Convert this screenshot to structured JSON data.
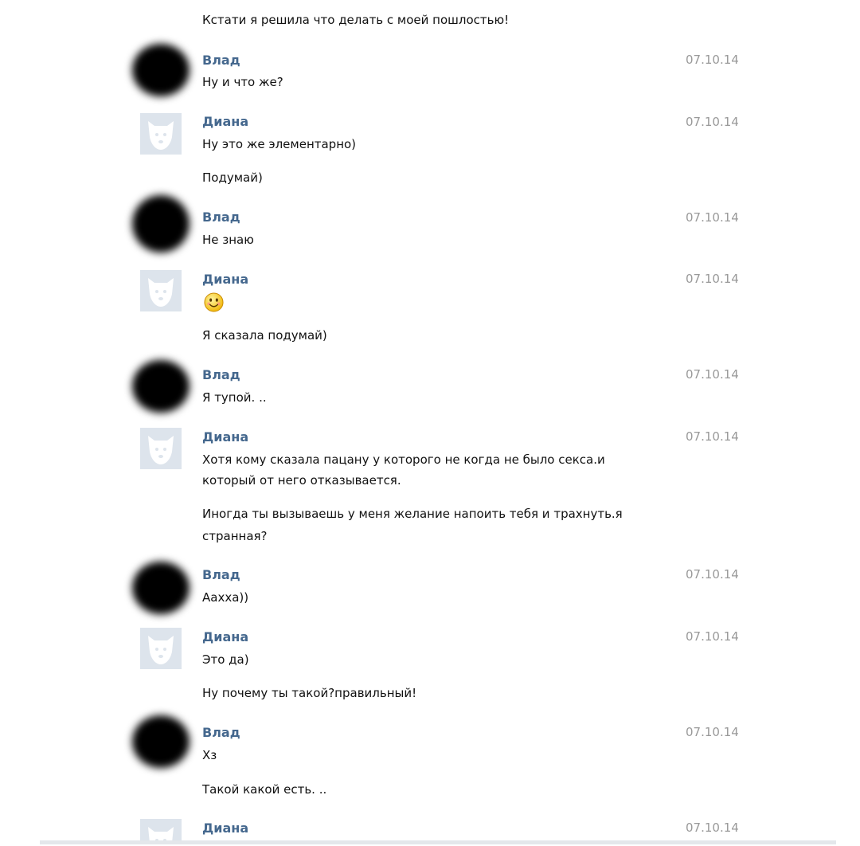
{
  "messages": [
    {
      "type": "text",
      "text": "Кстати я решила что делать с моей пошлостью!"
    },
    {
      "type": "header",
      "author": "Влад",
      "date": "07.10.14"
    },
    {
      "type": "text",
      "text": "Ну и что же?"
    },
    {
      "type": "header",
      "author": "Диана",
      "date": "07.10.14"
    },
    {
      "type": "text",
      "text": "Ну это же элементарно)"
    },
    {
      "type": "text",
      "text": "Подумай)"
    },
    {
      "type": "header",
      "author": "Влад",
      "date": "07.10.14"
    },
    {
      "type": "text",
      "text": "Не знаю"
    },
    {
      "type": "header",
      "author": "Диана",
      "date": "07.10.14"
    },
    {
      "type": "text",
      "text": "Я сказала подумай)"
    },
    {
      "type": "header",
      "author": "Влад",
      "date": "07.10.14"
    },
    {
      "type": "text",
      "text": "Я тупой. .."
    },
    {
      "type": "header",
      "author": "Диана",
      "date": "07.10.14"
    },
    {
      "type": "text",
      "text": "Хотя кому сказала пацану у которого не когда не было секса.и"
    },
    {
      "type": "text",
      "text": "который от него отказывается."
    },
    {
      "type": "text",
      "text": "Иногда ты вызываешь у меня желание напоить тебя и трахнуть.я"
    },
    {
      "type": "text",
      "text": "странная?"
    },
    {
      "type": "header",
      "author": "Влад",
      "date": "07.10.14"
    },
    {
      "type": "text",
      "text": "Аахха))"
    },
    {
      "type": "header",
      "author": "Диана",
      "date": "07.10.14"
    },
    {
      "type": "text",
      "text": "Это да)"
    },
    {
      "type": "text",
      "text": "Ну почему ты такой?правильный!"
    },
    {
      "type": "header",
      "author": "Влад",
      "date": "07.10.14"
    },
    {
      "type": "text",
      "text": "Хз"
    },
    {
      "type": "text",
      "text": "Такой какой есть. .."
    },
    {
      "type": "header",
      "author": "Диана",
      "date": "07.10.14"
    }
  ],
  "icons": {
    "smile": "smile-emoji-icon",
    "blurred_avatar": "blurred-user-avatar",
    "default_avatar": "default-dog-avatar-icon"
  },
  "colors": {
    "author": "#45688e",
    "date": "#999999",
    "avatar_bg": "#dde4ec"
  }
}
